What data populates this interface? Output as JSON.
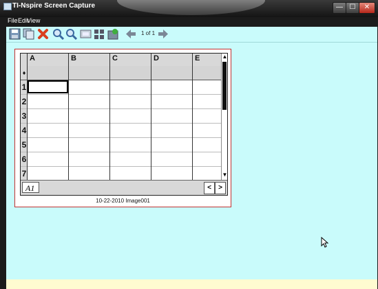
{
  "window": {
    "title": "TI-Nspire Screen Capture",
    "minimize": "—",
    "maximize": "☐",
    "close": "✕"
  },
  "menu": [
    "File",
    "Edit",
    "View"
  ],
  "toolbar": {
    "page_indicator": "1 of 1"
  },
  "spreadsheet": {
    "columns": [
      "A",
      "B",
      "C",
      "D",
      "E"
    ],
    "formula_marker": "♦",
    "rows": [
      "1",
      "2",
      "3",
      "4",
      "5",
      "6",
      "7"
    ],
    "selected_cell": "A1",
    "scroll_up": "▲",
    "scroll_down": "▼",
    "nav_left": "<",
    "nav_right": ">"
  },
  "caption": "10-22-2010 Image001",
  "colors": {
    "accent": "#c9fbfb",
    "status": "#fffbd0",
    "frame_border": "#c03030"
  }
}
